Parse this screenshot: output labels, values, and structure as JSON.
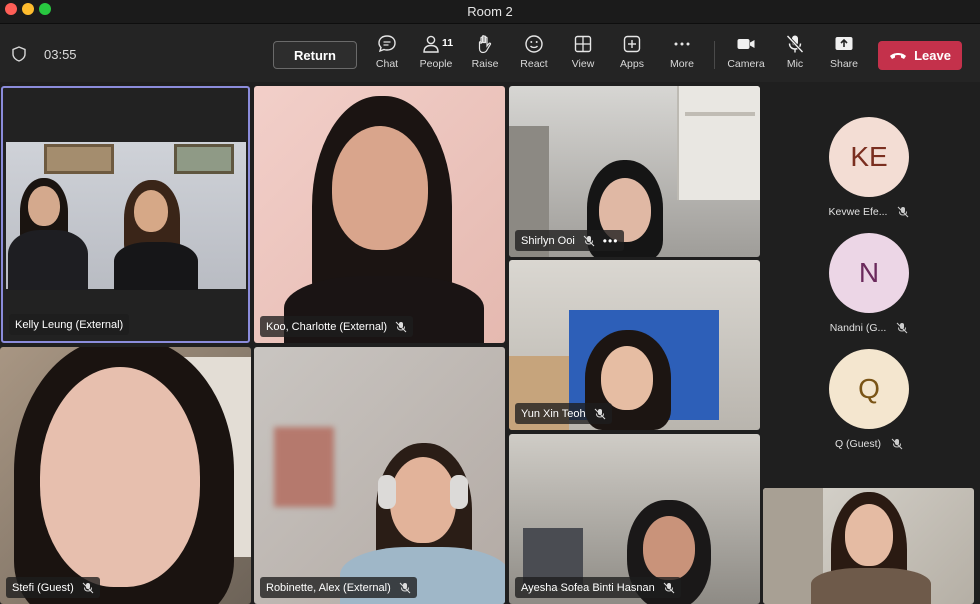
{
  "window": {
    "title": "Room 2"
  },
  "toolbar": {
    "timer": "03:55",
    "return_label": "Return",
    "chat_label": "Chat",
    "people_label": "People",
    "people_count": "11",
    "raise_label": "Raise",
    "react_label": "React",
    "view_label": "View",
    "apps_label": "Apps",
    "more_label": "More",
    "camera_label": "Camera",
    "mic_label": "Mic",
    "share_label": "Share",
    "leave_label": "Leave"
  },
  "tiles": [
    {
      "name": "Kelly Leung (External)"
    },
    {
      "name": "Koo, Charlotte (External)"
    },
    {
      "name": "Shirlyn Ooi"
    },
    {
      "name": "Yun Xin Teoh"
    },
    {
      "name": "Stefi (Guest)"
    },
    {
      "name": "Robinette, Alex (External)"
    },
    {
      "name": "Ayesha Sofea Binti Hasnan"
    }
  ],
  "roster": [
    {
      "initials": "KE",
      "name": "Kevwe Efe...",
      "bg": "#f3ddd4",
      "fg": "#7a2e1f"
    },
    {
      "initials": "N",
      "name": "Nandni (G...",
      "bg": "#ecd6e6",
      "fg": "#6b2a5c"
    },
    {
      "initials": "Q",
      "name": "Q (Guest)",
      "bg": "#f4e6cf",
      "fg": "#7a5416"
    }
  ],
  "colors": {
    "accent": "#8b8cdb",
    "leave": "#c4314b"
  }
}
